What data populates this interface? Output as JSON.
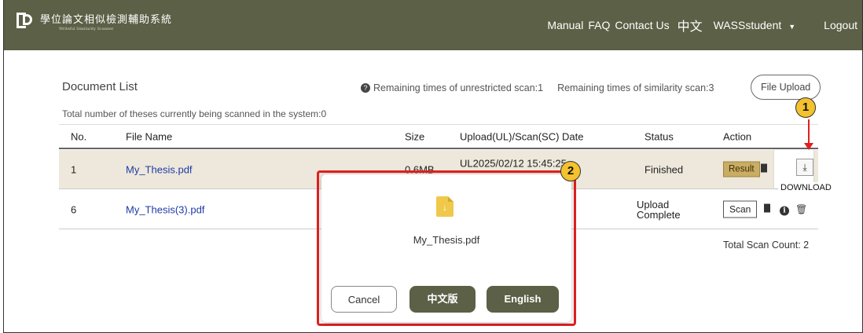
{
  "header": {
    "logo_zh": "學位論文相似檢測輔助系統",
    "logo_en": "Writeful Similarity Scanner",
    "nav": {
      "manual": "Manual",
      "faq": "FAQ",
      "contact": "Contact Us",
      "lang": "中文",
      "user": "WASSstudent",
      "logout": "Logout"
    }
  },
  "content": {
    "title": "Document List",
    "remain_unrestricted": "Remaining times of unrestricted scan:1",
    "remain_similarity": "Remaining times of similarity scan:3",
    "upload_label": "File Upload",
    "total_system": "Total number of theses currently being scanned in the system:0",
    "total_scan": "Total Scan Count: 2"
  },
  "table": {
    "headers": {
      "no": "No.",
      "name": "File Name",
      "size": "Size",
      "date": "Upload(UL)/Scan(SC) Date",
      "status": "Status",
      "action": "Action"
    },
    "rows": [
      {
        "no": "1",
        "name": "My_Thesis.pdf",
        "size": "0.6MB",
        "date": "UL2025/02/12 15:45:25",
        "status": "Finished",
        "action": "Result"
      },
      {
        "no": "6",
        "name": "My_Thesis(3).pdf",
        "status_line1": "Upload",
        "status_line2": "Complete",
        "action": "Scan"
      }
    ]
  },
  "download_tooltip": "DOWNLOAD",
  "callouts": [
    "1",
    "2"
  ],
  "modal": {
    "filename": "My_Thesis.pdf",
    "cancel": "Cancel",
    "zh": "中文版",
    "en": "English"
  },
  "colors": {
    "header_bg": "#5b6046",
    "highlight_row": "#ede8db",
    "result_btn": "#c9ad63",
    "callout": "#f3c22c",
    "annotation_red": "#e02020"
  }
}
